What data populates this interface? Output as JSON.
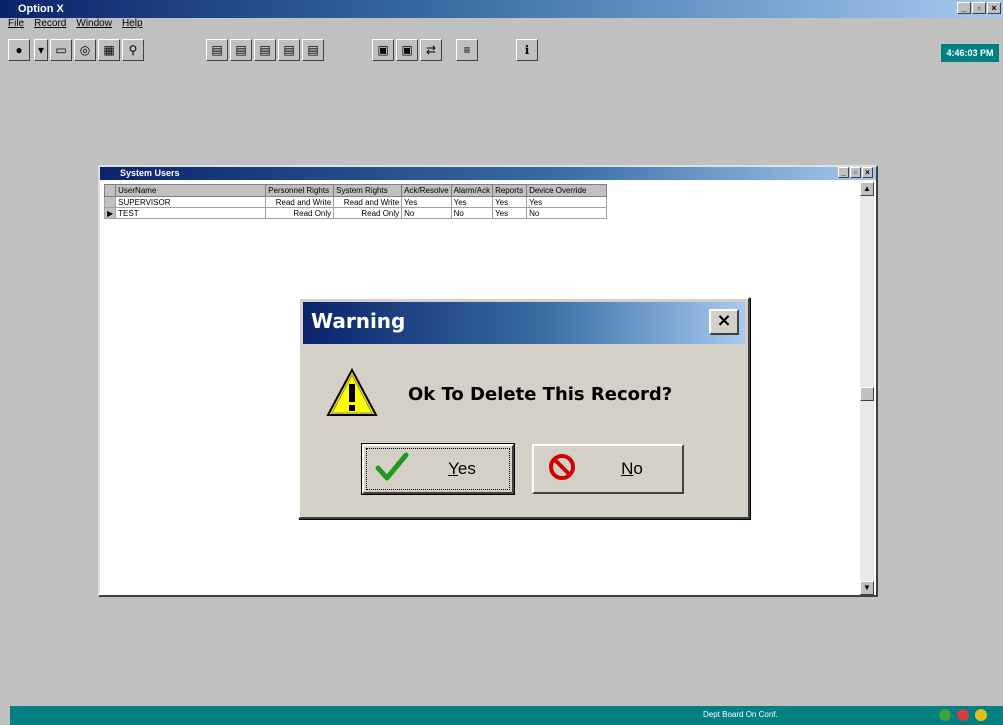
{
  "app": {
    "title": "Option X"
  },
  "menu": [
    "File",
    "Record",
    "Window",
    "Help"
  ],
  "toolbar": {
    "icons": [
      "exit-icon",
      "dropdown-icon",
      "monitor-icon",
      "alarm-icon",
      "calendar-icon",
      "search-icon",
      "doc-icon-1",
      "doc-icon-2",
      "doc-icon-3",
      "doc-icon-4",
      "doc-icon-5",
      "network-icon",
      "device-icon",
      "refresh-icon",
      "list-icon",
      "info-icon"
    ],
    "clock": "4:46:03 PM"
  },
  "child_window": {
    "title": "System Users",
    "columns": [
      "UserName",
      "Personnel Rights",
      "System Rights",
      "Ack/Resolve",
      "Alarm/Ack",
      "Reports",
      "Device Override"
    ],
    "rows": [
      {
        "selector": "",
        "UserName": "SUPERVISOR",
        "Personnel Rights": "Read and Write",
        "System Rights": "Read and Write",
        "Ack/Resolve": "Yes",
        "Alarm/Ack": "Yes",
        "Reports": "Yes",
        "Device Override": "Yes"
      },
      {
        "selector": "▶",
        "UserName": "TEST",
        "Personnel Rights": "Read Only",
        "System Rights": "Read Only",
        "Ack/Resolve": "No",
        "Alarm/Ack": "No",
        "Reports": "Yes",
        "Device Override": "No"
      }
    ]
  },
  "dialog": {
    "title": "Warning",
    "close_glyph": "×",
    "message": "Ok To Delete This Record?",
    "yes_label": "Yes",
    "no_label": "No"
  },
  "status": {
    "text": "Dept Board On Conf."
  },
  "colors": {
    "titlebar": "#0a246a",
    "status": "#008080",
    "desktop": "#c0c0c0"
  }
}
